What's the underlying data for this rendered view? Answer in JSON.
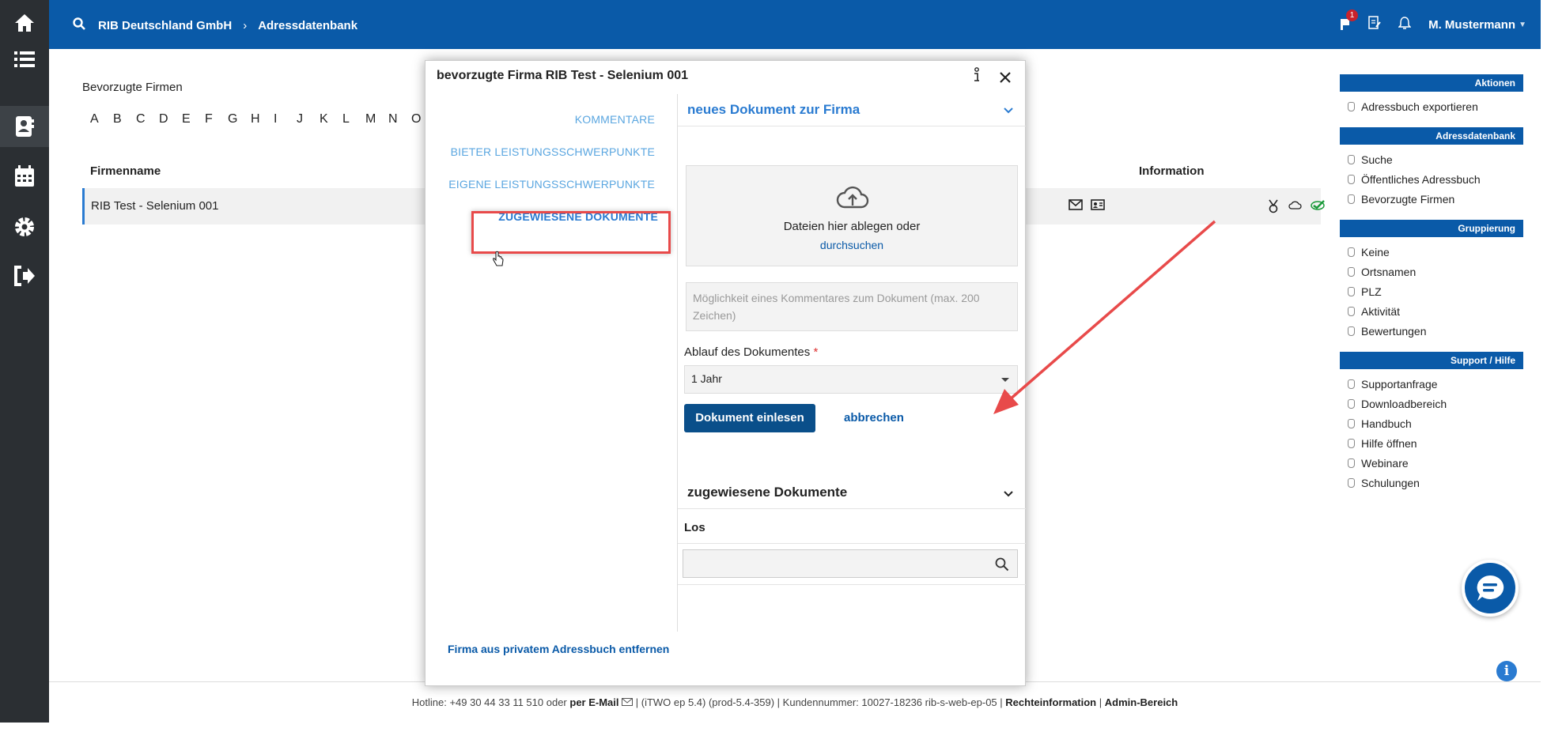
{
  "topbar": {
    "company": "RIB Deutschland GmbH",
    "section": "Adressdatenbank",
    "notification_count": "1",
    "user": "M. Mustermann"
  },
  "main": {
    "title": "Bevorzugte Firmen",
    "letters": [
      "A",
      "B",
      "C",
      "D",
      "E",
      "F",
      "G",
      "H",
      "I",
      "J",
      "K",
      "L",
      "M",
      "N",
      "O"
    ],
    "col_name": "Firmenname",
    "col_info": "Information",
    "row_name": "RIB Test - Selenium 001"
  },
  "right_panel": [
    {
      "header": "Aktionen",
      "items": [
        "Adressbuch exportieren"
      ]
    },
    {
      "header": "Adressdatenbank",
      "items": [
        "Suche",
        "Öffentliches Adressbuch",
        "Bevorzugte Firmen"
      ]
    },
    {
      "header": "Gruppierung",
      "items": [
        "Keine",
        "Ortsnamen",
        "PLZ",
        "Aktivität",
        "Bewertungen"
      ]
    },
    {
      "header": "Support / Hilfe",
      "items": [
        "Supportanfrage",
        "Downloadbereich",
        "Handbuch",
        "Hilfe öffnen",
        "Webinare",
        "Schulungen"
      ]
    }
  ],
  "modal": {
    "title": "bevorzugte Firma RIB Test - Selenium 001",
    "nav": [
      "KOMMENTARE",
      "BIETER LEISTUNGSSCHWERPUNKTE",
      "EIGENE LEISTUNGSSCHWERPUNKTE",
      "ZUGEWIESENE DOKUMENTE"
    ],
    "remove_link": "Firma aus privatem Adressbuch entfernen",
    "new_doc_header": "neues Dokument zur Firma",
    "drop_text": "Dateien hier ablegen oder",
    "browse_link": "durchsuchen",
    "comment_placeholder": "Möglichkeit eines Kommentares zum Dokument (max. 200 Zeichen)",
    "expiry_label": "Ablauf des Dokumentes",
    "expiry_required": "*",
    "expiry_value": "1 Jahr",
    "submit_label": "Dokument einlesen",
    "cancel_label": "abbrechen",
    "assigned_header": "zugewiesene Dokumente",
    "los_label": "Los"
  },
  "footer": {
    "hotline": "Hotline: +49 30 44 33 11 510 oder",
    "email": "per E-Mail",
    "version": "| (iTWO ep 5.4) (prod-5.4-359) | Kundennummer: 10027-18236 rib-s-web-ep-05 |",
    "legal": "Rechteinformation",
    "sep": "|",
    "admin": "Admin-Bereich"
  },
  "colors": {
    "brand": "#0a5aa8",
    "sidebar": "#2b2f33",
    "highlight": "#e84a4a"
  }
}
